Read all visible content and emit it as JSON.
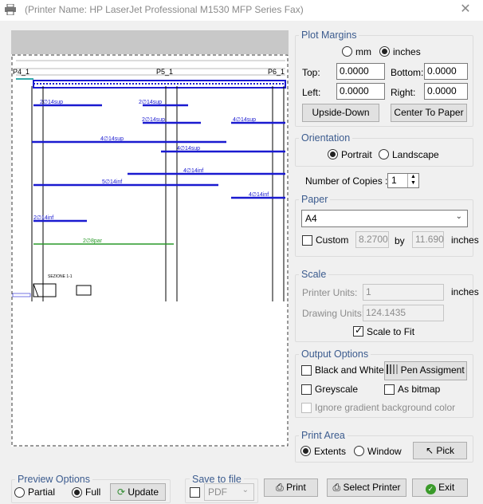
{
  "window": {
    "title": "(Printer Name: HP LaserJet Professional M1530 MFP Series Fax)",
    "close": "✕"
  },
  "preview": {
    "labels": [
      "P4_1",
      "P5_1",
      "P6_1"
    ],
    "section_label": "SEZIONE 1-1",
    "bar_labels": [
      "2∅14sup",
      "2∅14sup",
      "2∅14sup",
      "4∅14sup",
      "4∅14sup",
      "4∅14sup",
      "4∅14inf",
      "5∅14inf",
      "4∅14inf",
      "2∅14inf",
      "2∅8par"
    ]
  },
  "plot_margins": {
    "title": "Plot Margins",
    "unit_mm": "mm",
    "unit_inches": "inches",
    "selected_unit": "inches",
    "top_label": "Top:",
    "top_value": "0.0000",
    "bottom_label": "Bottom:",
    "bottom_value": "0.0000",
    "left_label": "Left:",
    "left_value": "0.0000",
    "right_label": "Right:",
    "right_value": "0.0000",
    "upside_down": "Upside-Down",
    "center": "Center To Paper"
  },
  "orientation": {
    "title": "Orientation",
    "portrait": "Portrait",
    "landscape": "Landscape",
    "selected": "Portrait"
  },
  "copies": {
    "label": "Number of Copies :",
    "value": "1"
  },
  "paper": {
    "title": "Paper",
    "size": "A4",
    "custom_label": "Custom",
    "width": "8.2700",
    "by": "by",
    "height": "11.690",
    "unit": "inches"
  },
  "scale": {
    "title": "Scale",
    "printer_units_label": "Printer Units:",
    "printer_units_value": "1",
    "unit": "inches",
    "drawing_units_label": "Drawing Units:",
    "drawing_units_value": "124.1435",
    "scale_to_fit": "Scale to Fit"
  },
  "output_options": {
    "title": "Output Options",
    "black_white": "Black and White",
    "pen_assignment": "Pen Assigment",
    "greyscale": "Greyscale",
    "as_bitmap": "As bitmap",
    "ignore_gradient": "Ignore gradient background color"
  },
  "print_area": {
    "title": "Print Area",
    "extents": "Extents",
    "window": "Window",
    "pick": "Pick",
    "selected": "Extents"
  },
  "preview_options": {
    "title": "Preview Options",
    "partial": "Partial",
    "full": "Full",
    "update": "Update",
    "selected": "Full"
  },
  "save_to_file": {
    "title": "Save to file",
    "format": "PDF"
  },
  "actions": {
    "print": "Print",
    "select_printer": "Select Printer",
    "exit": "Exit"
  },
  "colors": {
    "bar_blue": "#1a1ad0",
    "green": "#2a9a2a",
    "group_title": "#3b5b8e"
  }
}
